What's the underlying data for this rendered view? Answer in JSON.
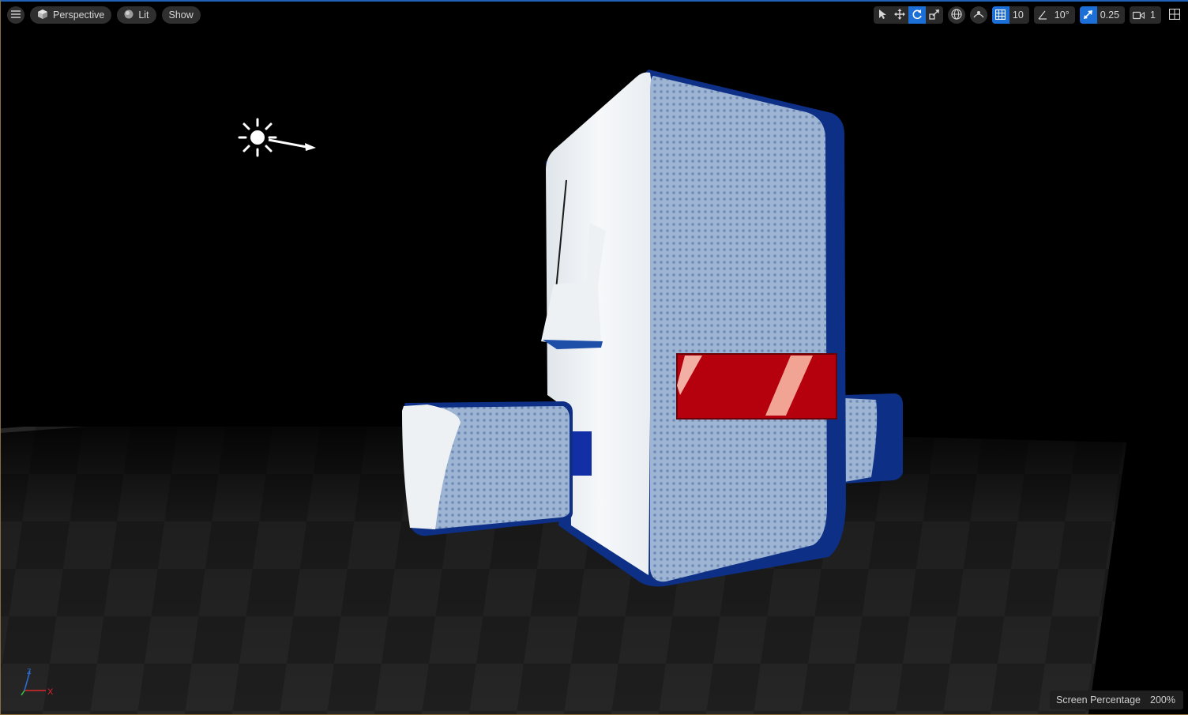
{
  "toolbar": {
    "view_mode": "Perspective",
    "lighting_mode": "Lit",
    "show_menu": "Show",
    "grid_snap_value": "10",
    "rotation_snap_value": "10°",
    "scale_snap_value": "0.25",
    "camera_speed": "1"
  },
  "axis_gizmo": {
    "x_label": "X",
    "z_label": "Z"
  },
  "status": {
    "screen_percentage_label": "Screen Percentage",
    "screen_percentage_value": "200%"
  },
  "colors": {
    "accent": "#1b6fd6",
    "toolbar_bg": "#2f2f2f",
    "robot_blue": "#0d2f85",
    "robot_panel": "#8ea9cc",
    "visor_red": "#b5000e"
  }
}
